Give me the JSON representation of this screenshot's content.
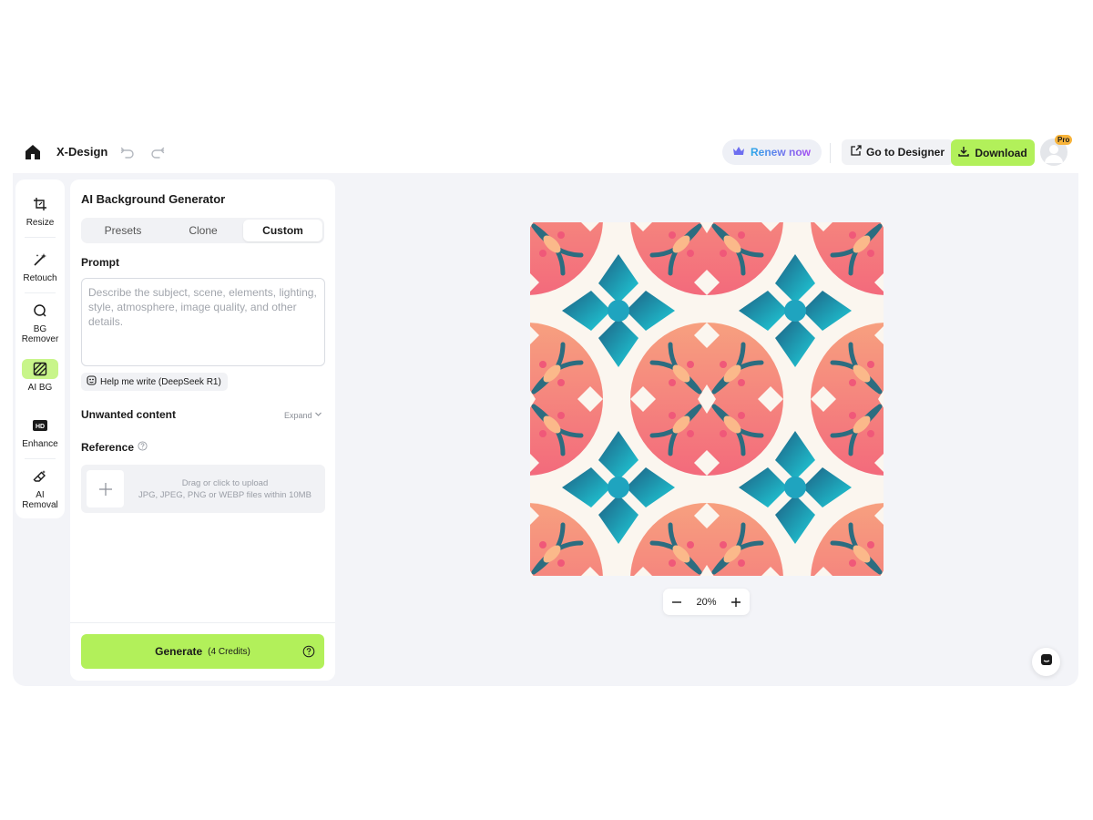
{
  "header": {
    "brand": "X-Design",
    "renew_label": "Renew now",
    "designer_label": "Go to Designer",
    "download_label": "Download",
    "pro_badge": "Pro",
    "icons": [
      "home-icon",
      "undo-icon",
      "redo-icon",
      "crown-icon",
      "external-edit-icon",
      "download-icon",
      "user-avatar-icon"
    ]
  },
  "rail": {
    "items": [
      {
        "label": "Resize",
        "icon": "crop-icon"
      },
      {
        "label": "Retouch",
        "icon": "magic-wand-icon"
      },
      {
        "label": "BG Remover",
        "icon": "bg-remover-icon"
      },
      {
        "label": "AI BG",
        "icon": "ai-bg-icon",
        "active": true
      },
      {
        "label": "Enhance",
        "icon": "hd-icon"
      },
      {
        "label": "AI Removal",
        "icon": "eraser-icon"
      }
    ]
  },
  "panel": {
    "title": "AI Background Generator",
    "tabs": [
      {
        "label": "Presets"
      },
      {
        "label": "Clone"
      },
      {
        "label": "Custom",
        "active": true
      }
    ],
    "prompt_label": "Prompt",
    "prompt_placeholder": "Describe the subject, scene, elements, lighting, style, atmosphere, image quality, and other details.",
    "prompt_value": "",
    "help_write_label": "Help me write (DeepSeek R1)",
    "unwanted_label": "Unwanted content",
    "expand_label": "Expand",
    "reference_label": "Reference",
    "upload_line1": "Drag or click to upload",
    "upload_line2": "JPG, JPEG, PNG or WEBP files within 10MB",
    "generate_label": "Generate",
    "generate_credits": "(4 Credits)"
  },
  "canvas": {
    "zoom": "20%",
    "pattern_colors": {
      "cream": "#fbf6ef",
      "coral": "#f4707f",
      "peach": "#fbc690",
      "teal_dark": "#1f6d88",
      "teal_light": "#22c4d6"
    }
  },
  "colors": {
    "accent": "#b2f05a",
    "panel_bg": "#f3f4f8"
  }
}
